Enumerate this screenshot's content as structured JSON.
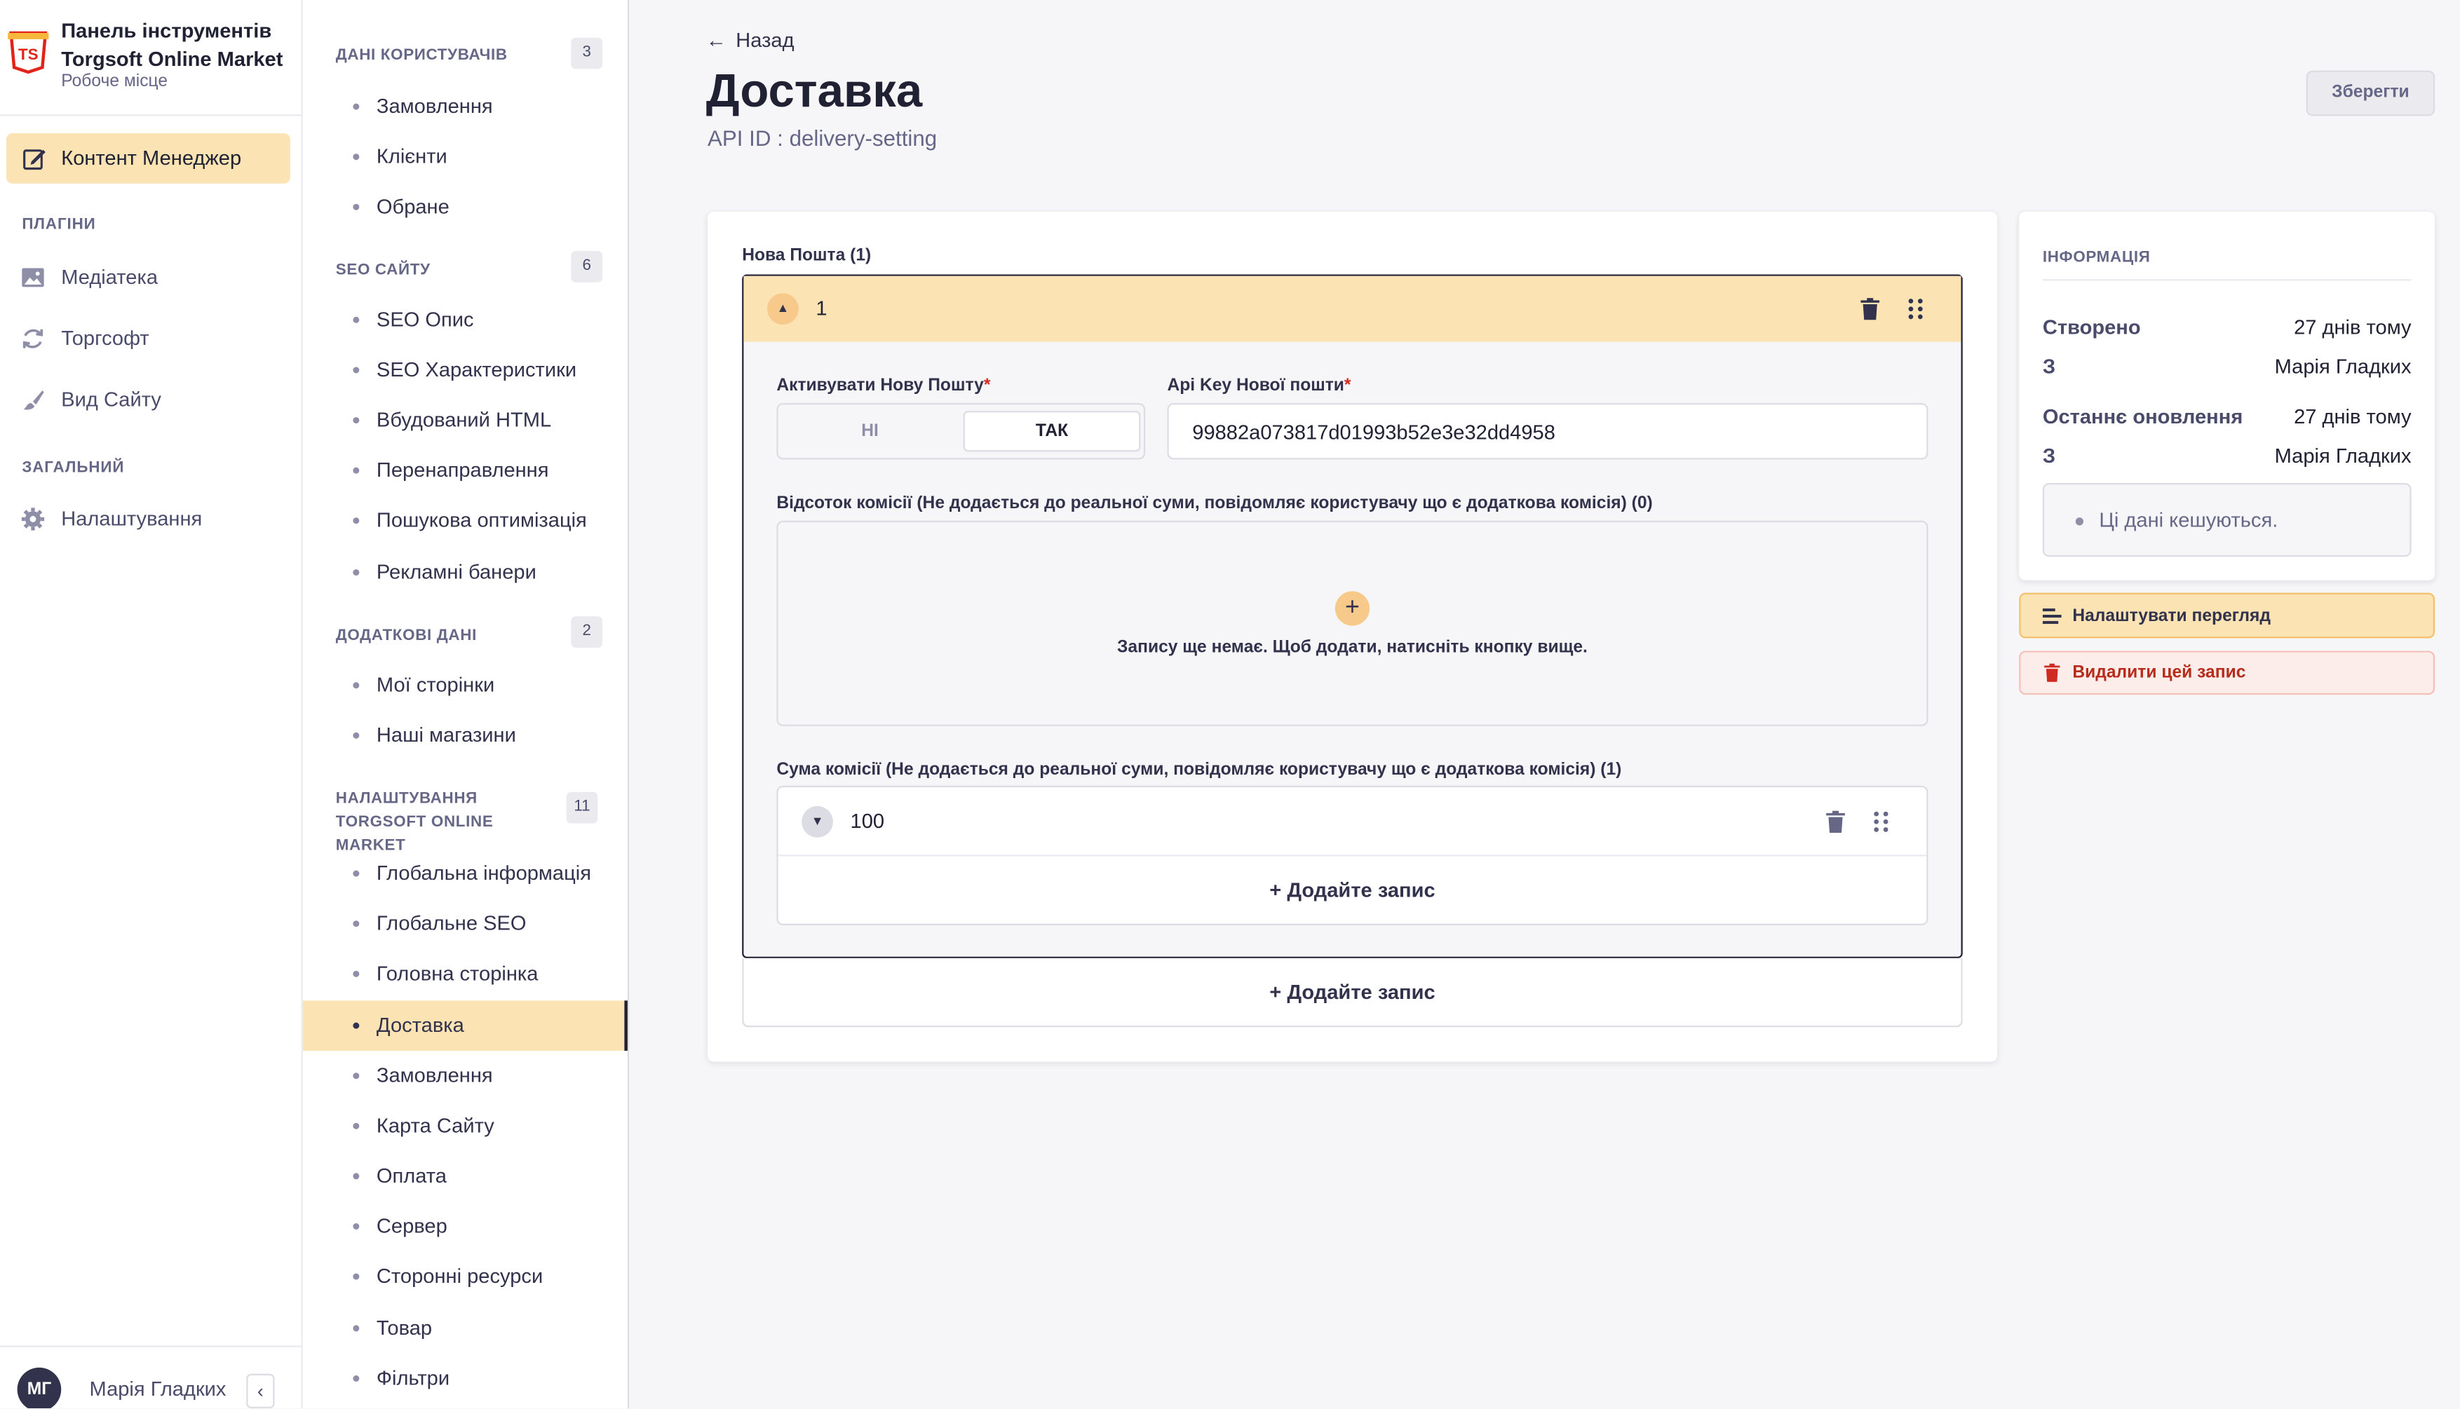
{
  "app": {
    "title": "Панель інструментів Torgsoft Online Market",
    "subtitle": "Робоче місце",
    "logo_text": "TS"
  },
  "main_nav": {
    "content_manager": "Контент Менеджер",
    "plugins_title": "ПЛАГІНИ",
    "plugins": [
      "Медіатека",
      "Торгсофт",
      "Вид Сайту"
    ],
    "general_title": "ЗАГАЛЬНИЙ",
    "settings": "Налаштування"
  },
  "user": {
    "initials": "МГ",
    "name": "Марія Гладких"
  },
  "sub_nav": {
    "groups": [
      {
        "title": "ДАНІ КОРИСТУВАЧІВ",
        "count": "3",
        "items": [
          "Замовлення",
          "Клієнти",
          "Обране"
        ]
      },
      {
        "title": "SEO САЙТУ",
        "count": "6",
        "items": [
          "SEO Опис",
          "SEO Характеристики",
          "Вбудований HTML",
          "Перенаправлення",
          "Пошукова оптимізація",
          "Рекламні банери"
        ]
      },
      {
        "title": "ДОДАТКОВІ ДАНІ",
        "count": "2",
        "items": [
          "Мої сторінки",
          "Наші магазини"
        ]
      },
      {
        "title": "НАЛАШТУВАННЯ TORGSOFT ONLINE MARKET",
        "count": "11",
        "items": [
          "Глобальна інформація",
          "Глобальне SEO",
          "Головна сторінка",
          "Доставка",
          "Замовлення",
          "Карта Сайту",
          "Оплата",
          "Сервер",
          "Сторонні ресурси",
          "Товар",
          "Фільтри"
        ]
      }
    ],
    "active_item": "Доставка"
  },
  "header": {
    "back": "Назад",
    "title": "Доставка",
    "api_id": "API ID : delivery-setting",
    "save": "Зберегти"
  },
  "form": {
    "component_label": "Нова Пошта (1)",
    "entry_index": "1",
    "activate_label": "Активувати Нову Пошту",
    "toggle_off": "НІ",
    "toggle_on": "ТАК",
    "toggle_value": true,
    "api_key_label": "Api Key Нової пошти",
    "api_key_value": "99882a073817d01993b52e3e32dd4958",
    "percent_label": "Відсоток комісії (Не додається до реальної суми, повідомляє користувачу що є додаткова комісія) (0)",
    "empty_text": "Запису ще немає. Щоб додати, натисніть кнопку вище.",
    "sum_label": "Сума комісії (Не додається до реальної суми, повідомляє користувачу що є додаткова комісія) (1)",
    "sum_value": "100",
    "add_entry": "Додайте запис",
    "required_mark": "*"
  },
  "info": {
    "title": "ІНФОРМАЦІЯ",
    "created_label": "Створено",
    "created_value": "27 днів тому",
    "by_label": "З",
    "created_by": "Марія Гладких",
    "updated_label": "Останнє оновлення",
    "updated_value": "27 днів тому",
    "updated_by": "Марія Гладких",
    "cache_note": "Ці дані кешуються."
  },
  "actions": {
    "configure_view": "Налаштувати перегляд",
    "delete_entry": "Видалити цей запис"
  },
  "colors": {
    "accent": "#fbe3b3",
    "accent_strong": "#f7c98a",
    "danger": "#b72b1a",
    "text": "#212134"
  }
}
